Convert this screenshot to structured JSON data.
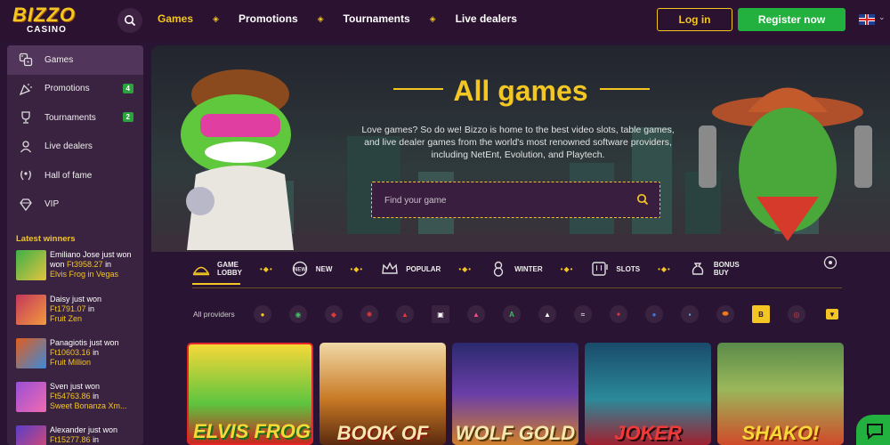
{
  "header": {
    "logo_main": "BIZZO",
    "logo_sub": "CASINO",
    "nav": [
      "Games",
      "Promotions",
      "Tournaments",
      "Live dealers"
    ],
    "login": "Log in",
    "register": "Register now",
    "accent": "#f3c623",
    "register_color": "#22b13e"
  },
  "sidebar": {
    "items": [
      {
        "label": "Games",
        "icon": "dice-icon"
      },
      {
        "label": "Promotions",
        "icon": "party-popper-icon",
        "badge": "4"
      },
      {
        "label": "Tournaments",
        "icon": "trophy-icon",
        "badge": "2"
      },
      {
        "label": "Live dealers",
        "icon": "dealer-icon"
      },
      {
        "label": "Hall of fame",
        "icon": "laurel-icon"
      },
      {
        "label": "VIP",
        "icon": "diamond-icon"
      }
    ],
    "winners_title": "Latest winners",
    "winners": [
      {
        "name": "Emiliano Jose just won",
        "amount": "Ft3958.27",
        "in": "in",
        "game": "Elvis Frog in Vegas"
      },
      {
        "name": "Daisy just won",
        "amount": "Ft1791.07",
        "in": "in",
        "game": "Fruit Zen"
      },
      {
        "name": "Panagiotis just won",
        "amount": "Ft10603.16",
        "in": "in",
        "game": "Fruit Million"
      },
      {
        "name": "Sven just won",
        "amount": "Ft54763.86",
        "in": "in",
        "game": "Sweet Bonanza Xm..."
      },
      {
        "name": "Alexander just won",
        "amount": "Ft15277.86",
        "in": "in",
        "game": ""
      }
    ]
  },
  "hero": {
    "title": "All games",
    "description": "Love games? So do we! Bizzo is home to the best video slots, table games, and live dealer games from the world's most renowned software providers, including NetEnt, Evolution, and Playtech.",
    "search_placeholder": "Find your game"
  },
  "categories": [
    {
      "label": "GAME LOBBY",
      "l1": "GAME",
      "l2": "LOBBY",
      "icon": "cloche-icon"
    },
    {
      "label": "NEW",
      "l1": "NEW",
      "l2": "",
      "icon": "new-badge-icon"
    },
    {
      "label": "POPULAR",
      "l1": "POPULAR",
      "l2": "",
      "icon": "crown-icon"
    },
    {
      "label": "WINTER",
      "l1": "WINTER",
      "l2": "",
      "icon": "snowman-icon"
    },
    {
      "label": "SLOTS",
      "l1": "SLOTS",
      "l2": "",
      "icon": "slot-machine-icon"
    },
    {
      "label": "BONUS BUY",
      "l1": "BONUS",
      "l2": "BUY",
      "icon": "money-bag-icon"
    }
  ],
  "providers_label": "All providers",
  "games": [
    {
      "title": "ELVIS FROG",
      "bg": "#2ea84a"
    },
    {
      "title": "BOOK OF",
      "bg": "#b5601c"
    },
    {
      "title": "WOLF GOLD",
      "bg": "#3a2b7a"
    },
    {
      "title": "JOKER",
      "bg": "#1f6e7a"
    },
    {
      "title": "SHAKO!",
      "bg": "#4a7a3a"
    }
  ]
}
